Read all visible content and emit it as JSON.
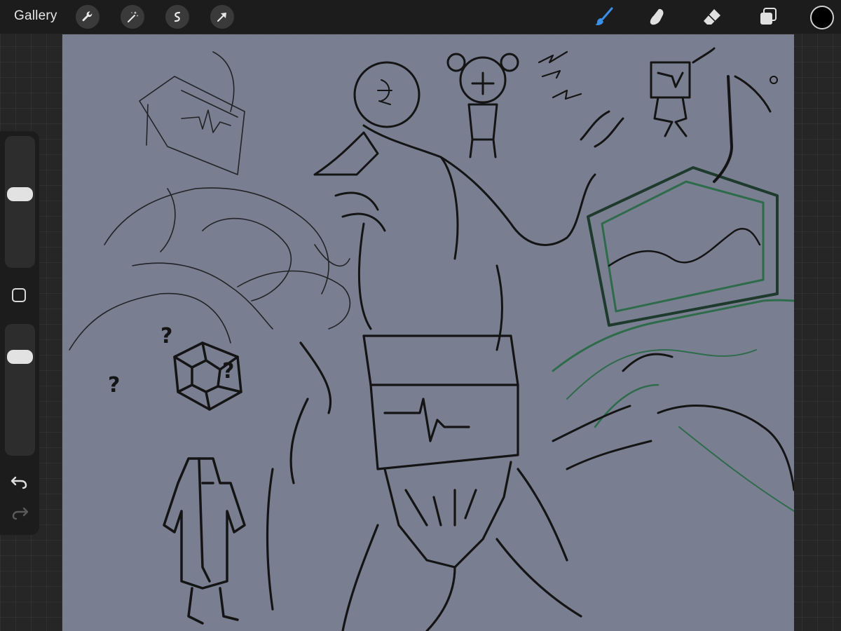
{
  "topbar": {
    "gallery_label": "Gallery",
    "left_tools": [
      "wrench-icon",
      "magic-wand-icon",
      "selection-icon",
      "transform-arrow-icon"
    ],
    "right_tools": [
      "brush-icon",
      "smudge-icon",
      "eraser-icon",
      "layers-icon"
    ],
    "active_tool": "brush-icon",
    "current_color": "#000000"
  },
  "sidebar": {
    "brush_size_fraction": 0.57,
    "opacity_fraction": 0.76,
    "modify_button": "square-icon",
    "undo_icon": "undo-icon",
    "redo_icon": "redo-icon"
  },
  "canvas": {
    "background_color": "#797f91",
    "stroke_color": "#141414",
    "accent_stroke_color": "#2e6b4a",
    "sketch_labels": [
      "?",
      "?",
      "?"
    ]
  },
  "colors": {
    "accent_blue": "#3a8fe8",
    "toolbar_bg": "#1c1c1c"
  }
}
